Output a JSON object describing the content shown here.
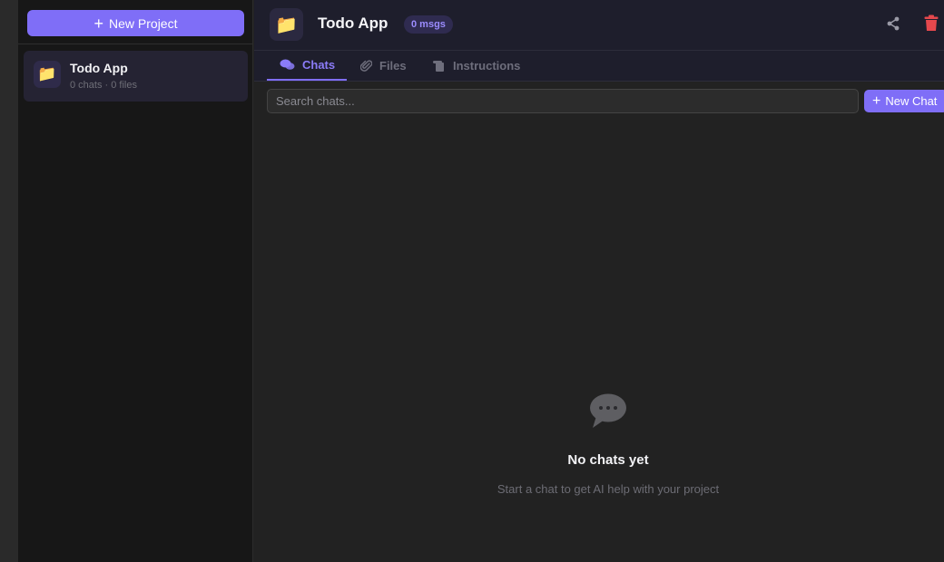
{
  "sidebar": {
    "new_project_label": "New Project",
    "projects": [
      {
        "icon": "📁",
        "name": "Todo App",
        "meta": "0 chats · 0 files"
      }
    ]
  },
  "header": {
    "icon": "📁",
    "title": "Todo App",
    "badge": "0 msgs"
  },
  "tabs": [
    {
      "label": "Chats",
      "icon": "chats-icon",
      "active": true
    },
    {
      "label": "Files",
      "icon": "paperclip-icon",
      "active": false
    },
    {
      "label": "Instructions",
      "icon": "scroll-icon",
      "active": false
    }
  ],
  "search": {
    "placeholder": "Search chats...",
    "value": ""
  },
  "new_chat_label": "New Chat",
  "empty_state": {
    "icon": "speech-bubble-icon",
    "title": "No chats yet",
    "subtitle": "Start a chat to get AI help with your project"
  },
  "colors": {
    "accent": "#7f6ef7",
    "accent_text": "#8b7cf8",
    "danger": "#e5484d"
  }
}
